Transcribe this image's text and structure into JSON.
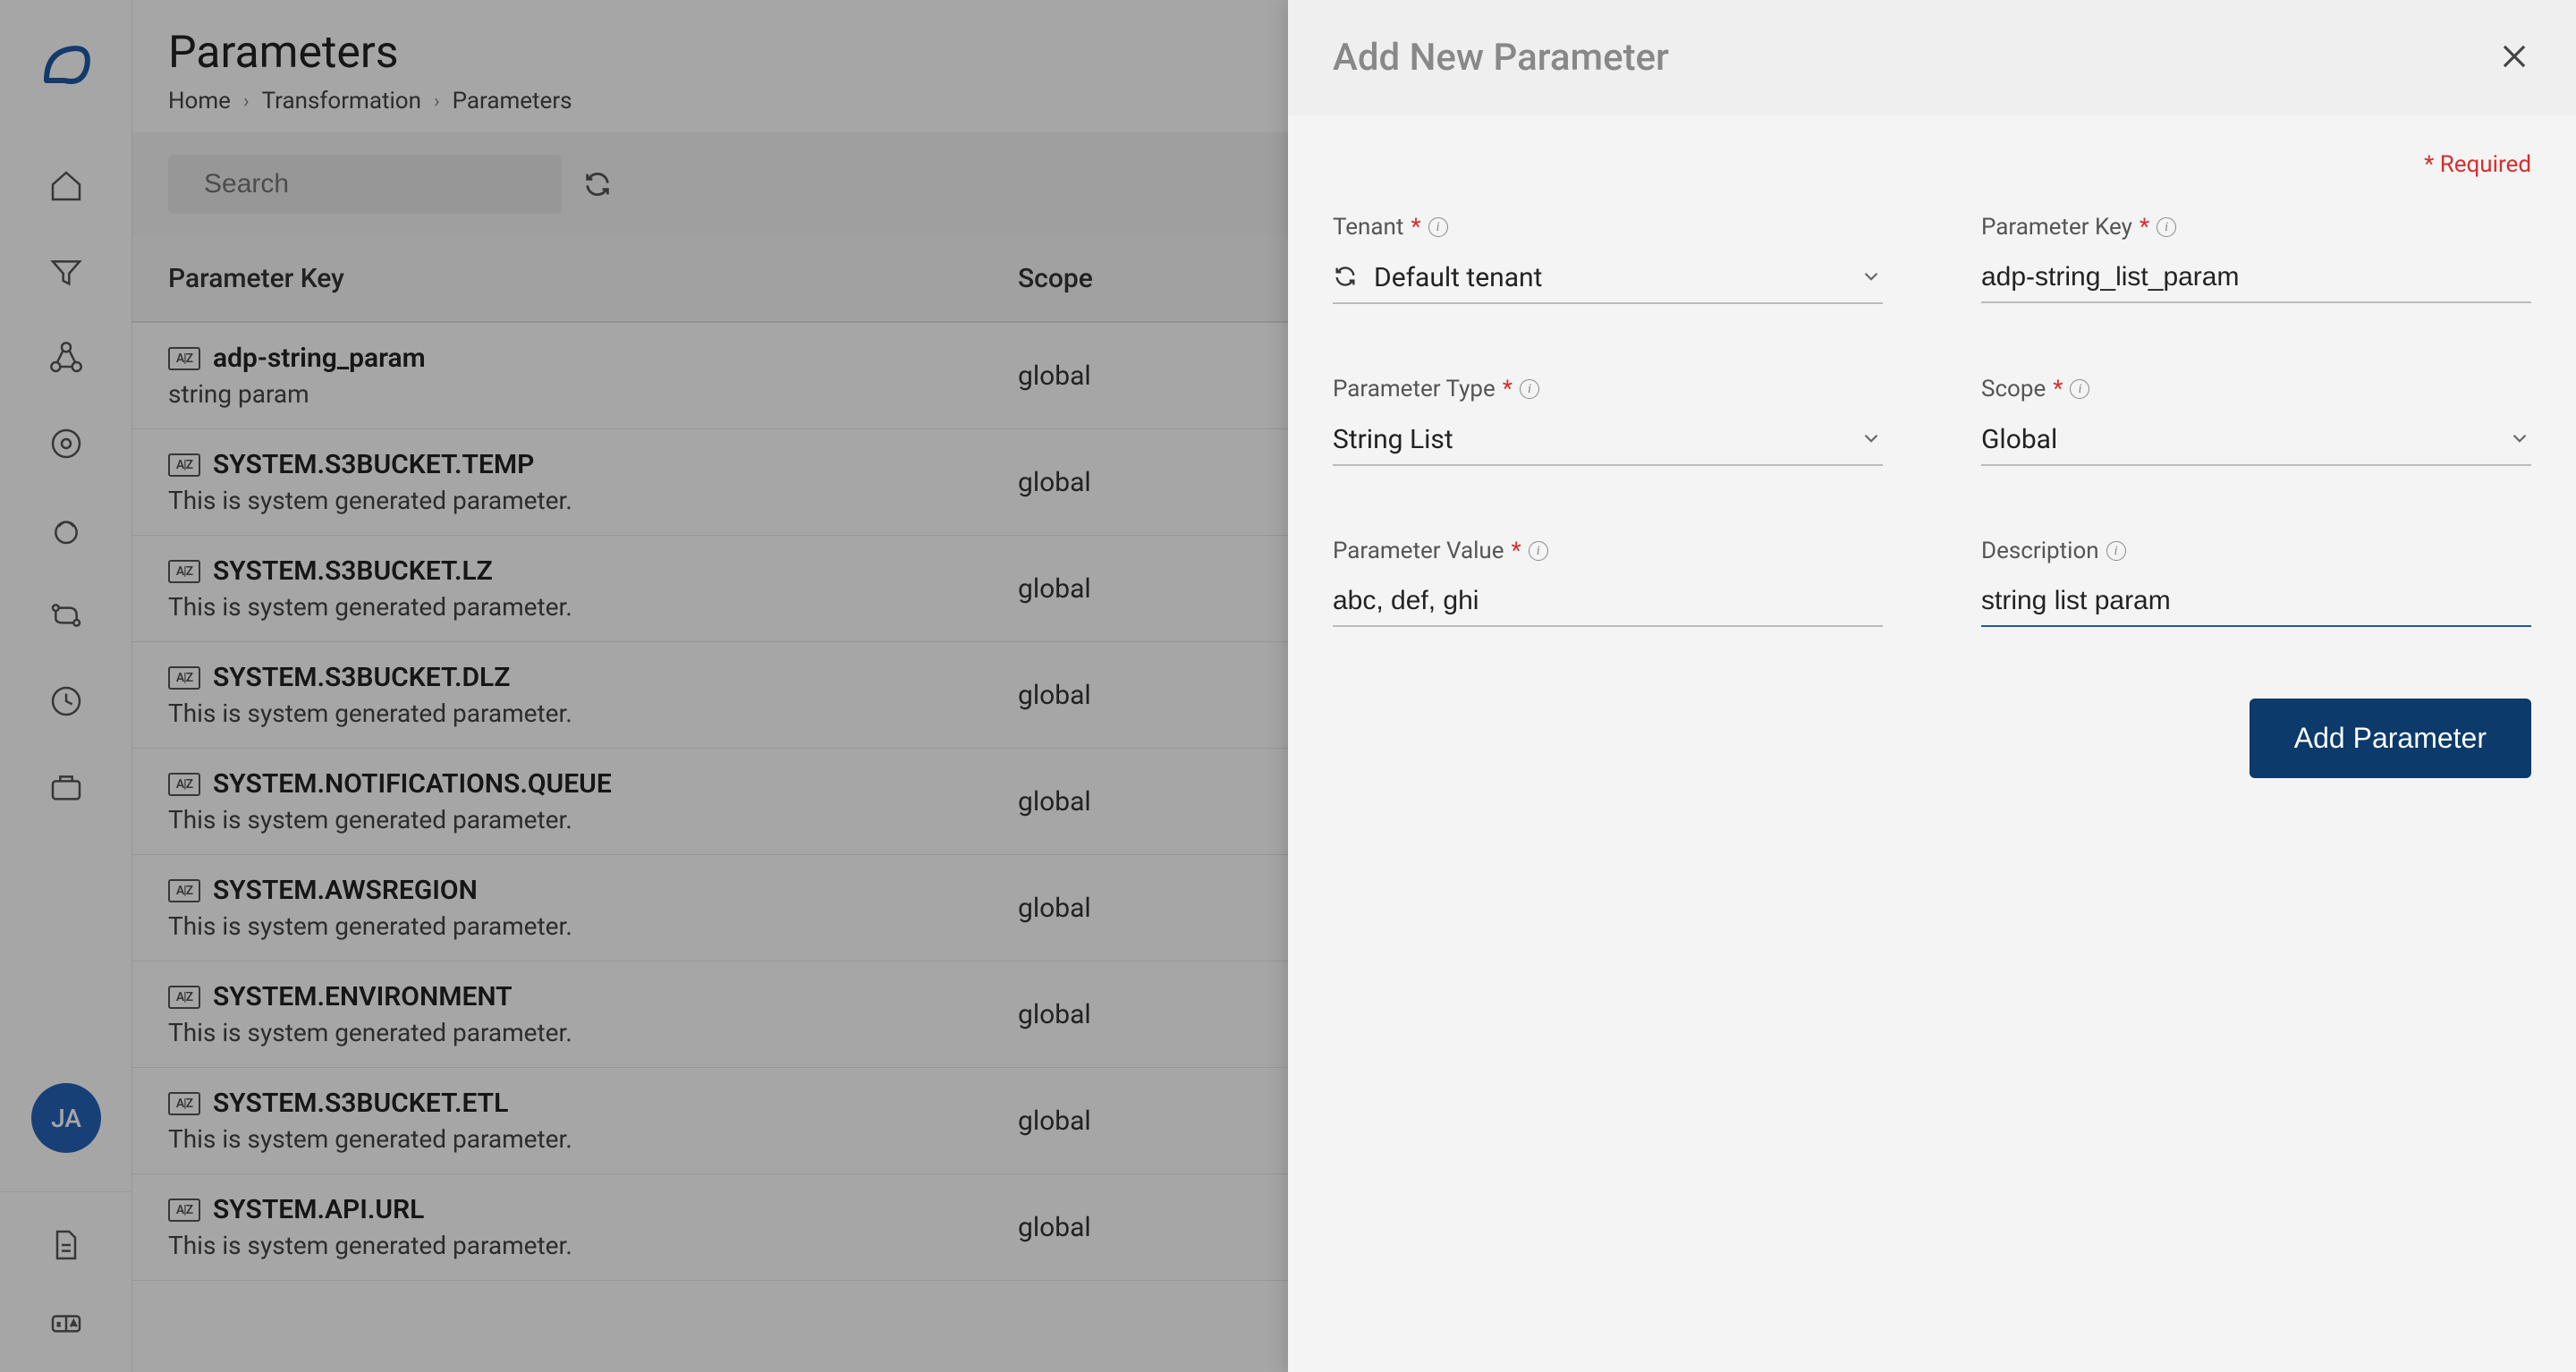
{
  "sidebar": {
    "avatar_initials": "JA"
  },
  "header": {
    "title": "Parameters",
    "breadcrumb": [
      "Home",
      "Transformation",
      "Parameters"
    ]
  },
  "toolbar": {
    "search_placeholder": "Search"
  },
  "table": {
    "columns": {
      "key": "Parameter Key",
      "scope": "Scope"
    },
    "rows": [
      {
        "key": "adp-string_param",
        "desc": "string param",
        "scope": "global"
      },
      {
        "key": "SYSTEM.S3BUCKET.TEMP",
        "desc": "This is system generated parameter.",
        "scope": "global"
      },
      {
        "key": "SYSTEM.S3BUCKET.LZ",
        "desc": "This is system generated parameter.",
        "scope": "global"
      },
      {
        "key": "SYSTEM.S3BUCKET.DLZ",
        "desc": "This is system generated parameter.",
        "scope": "global"
      },
      {
        "key": "SYSTEM.NOTIFICATIONS.QUEUE",
        "desc": "This is system generated parameter.",
        "scope": "global"
      },
      {
        "key": "SYSTEM.AWSREGION",
        "desc": "This is system generated parameter.",
        "scope": "global"
      },
      {
        "key": "SYSTEM.ENVIRONMENT",
        "desc": "This is system generated parameter.",
        "scope": "global"
      },
      {
        "key": "SYSTEM.S3BUCKET.ETL",
        "desc": "This is system generated parameter.",
        "scope": "global"
      },
      {
        "key": "SYSTEM.API.URL",
        "desc": "This is system generated parameter.",
        "scope": "global"
      }
    ]
  },
  "panel": {
    "title": "Add New Parameter",
    "required_note": "* Required",
    "fields": {
      "tenant": {
        "label": "Tenant",
        "value": "Default tenant"
      },
      "parameter_key": {
        "label": "Parameter Key",
        "value": "adp-string_list_param"
      },
      "parameter_type": {
        "label": "Parameter Type",
        "value": "String List"
      },
      "scope": {
        "label": "Scope",
        "value": "Global"
      },
      "parameter_value": {
        "label": "Parameter Value",
        "value": "abc, def, ghi"
      },
      "description": {
        "label": "Description",
        "value": "string list param"
      }
    },
    "submit_label": "Add Parameter"
  }
}
